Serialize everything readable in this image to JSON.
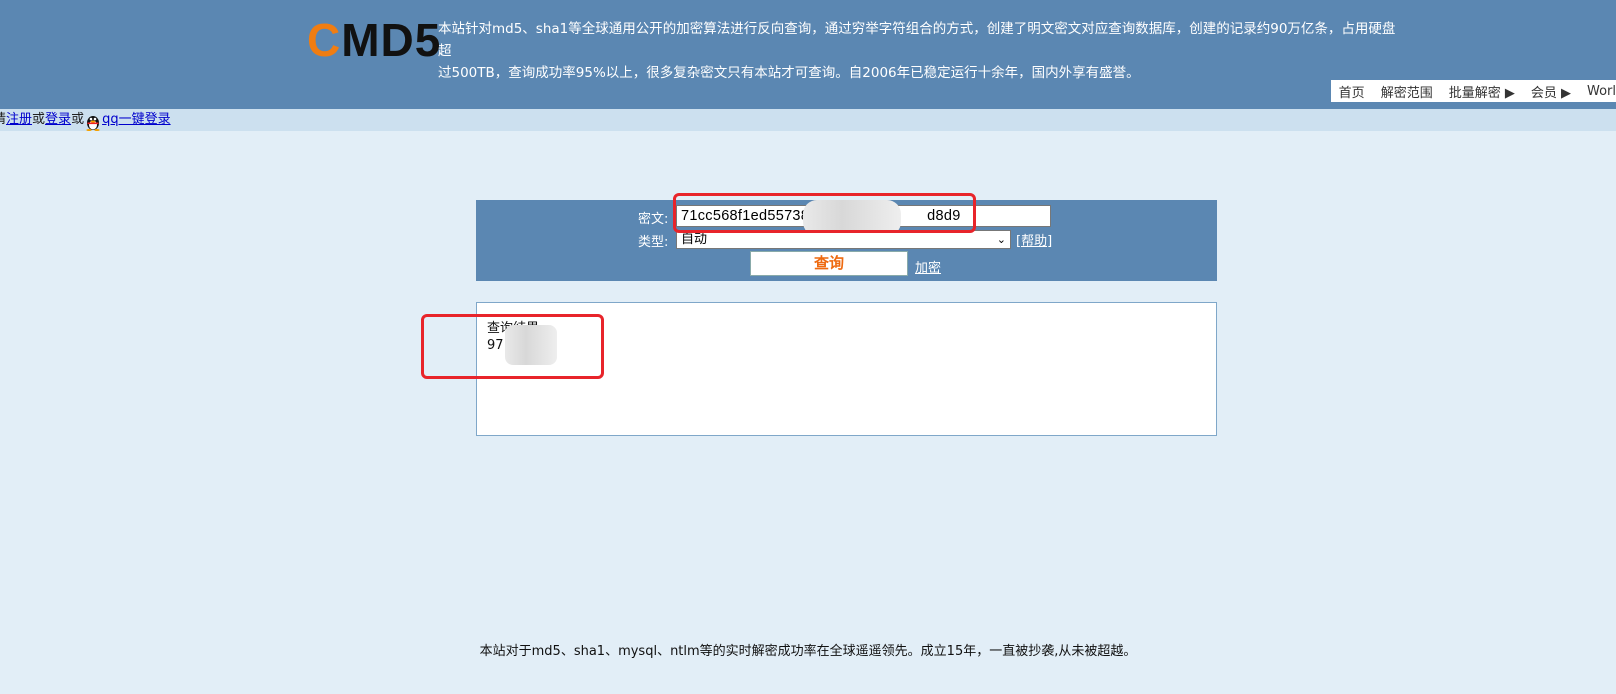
{
  "header": {
    "logo_c": "C",
    "logo_rest": "MD5",
    "intro_line1": "本站针对md5、sha1等全球通用公开的加密算法进行反向查询，通过穷举字符组合的方式，创建了明文密文对应查询数据库，创建的记录约90万亿条，占用硬盘超",
    "intro_line2": "过500TB，查询成功率95%以上，很多复杂密文只有本站才可查询。自2006年已稳定运行十余年，国内外享有盛誉。",
    "logo_color_c": "#f07d12",
    "header_bg": "#5b87b2"
  },
  "nav": {
    "items": [
      "首页",
      "解密范围",
      "批量解密 ▶",
      "会员 ▶",
      "Worl"
    ]
  },
  "login_bar": {
    "register_prefix": "请",
    "register": "注册",
    "or1": "或",
    "login": "登录",
    "or2": "或",
    "qq_login": "qq一键登录",
    "qq_icon": "qq-penguin-icon"
  },
  "query": {
    "cipher_label": "密文:",
    "cipher_value_start": "71cc568f1ed55738",
    "cipher_value_end": "d8d9",
    "type_label": "类型:",
    "type_value": "自动",
    "help_link": "[帮助]",
    "query_button": "查询",
    "encrypt_link": "加密"
  },
  "result": {
    "label": "查询结果:",
    "value_visible": "97"
  },
  "footer": {
    "note": "本站对于md5、sha1、mysql、ntlm等的实时解密成功率在全球遥遥领先。成立15年，一直被抄袭,从未被超越。"
  },
  "annotations": {
    "highlight_color": "#e8242a"
  }
}
